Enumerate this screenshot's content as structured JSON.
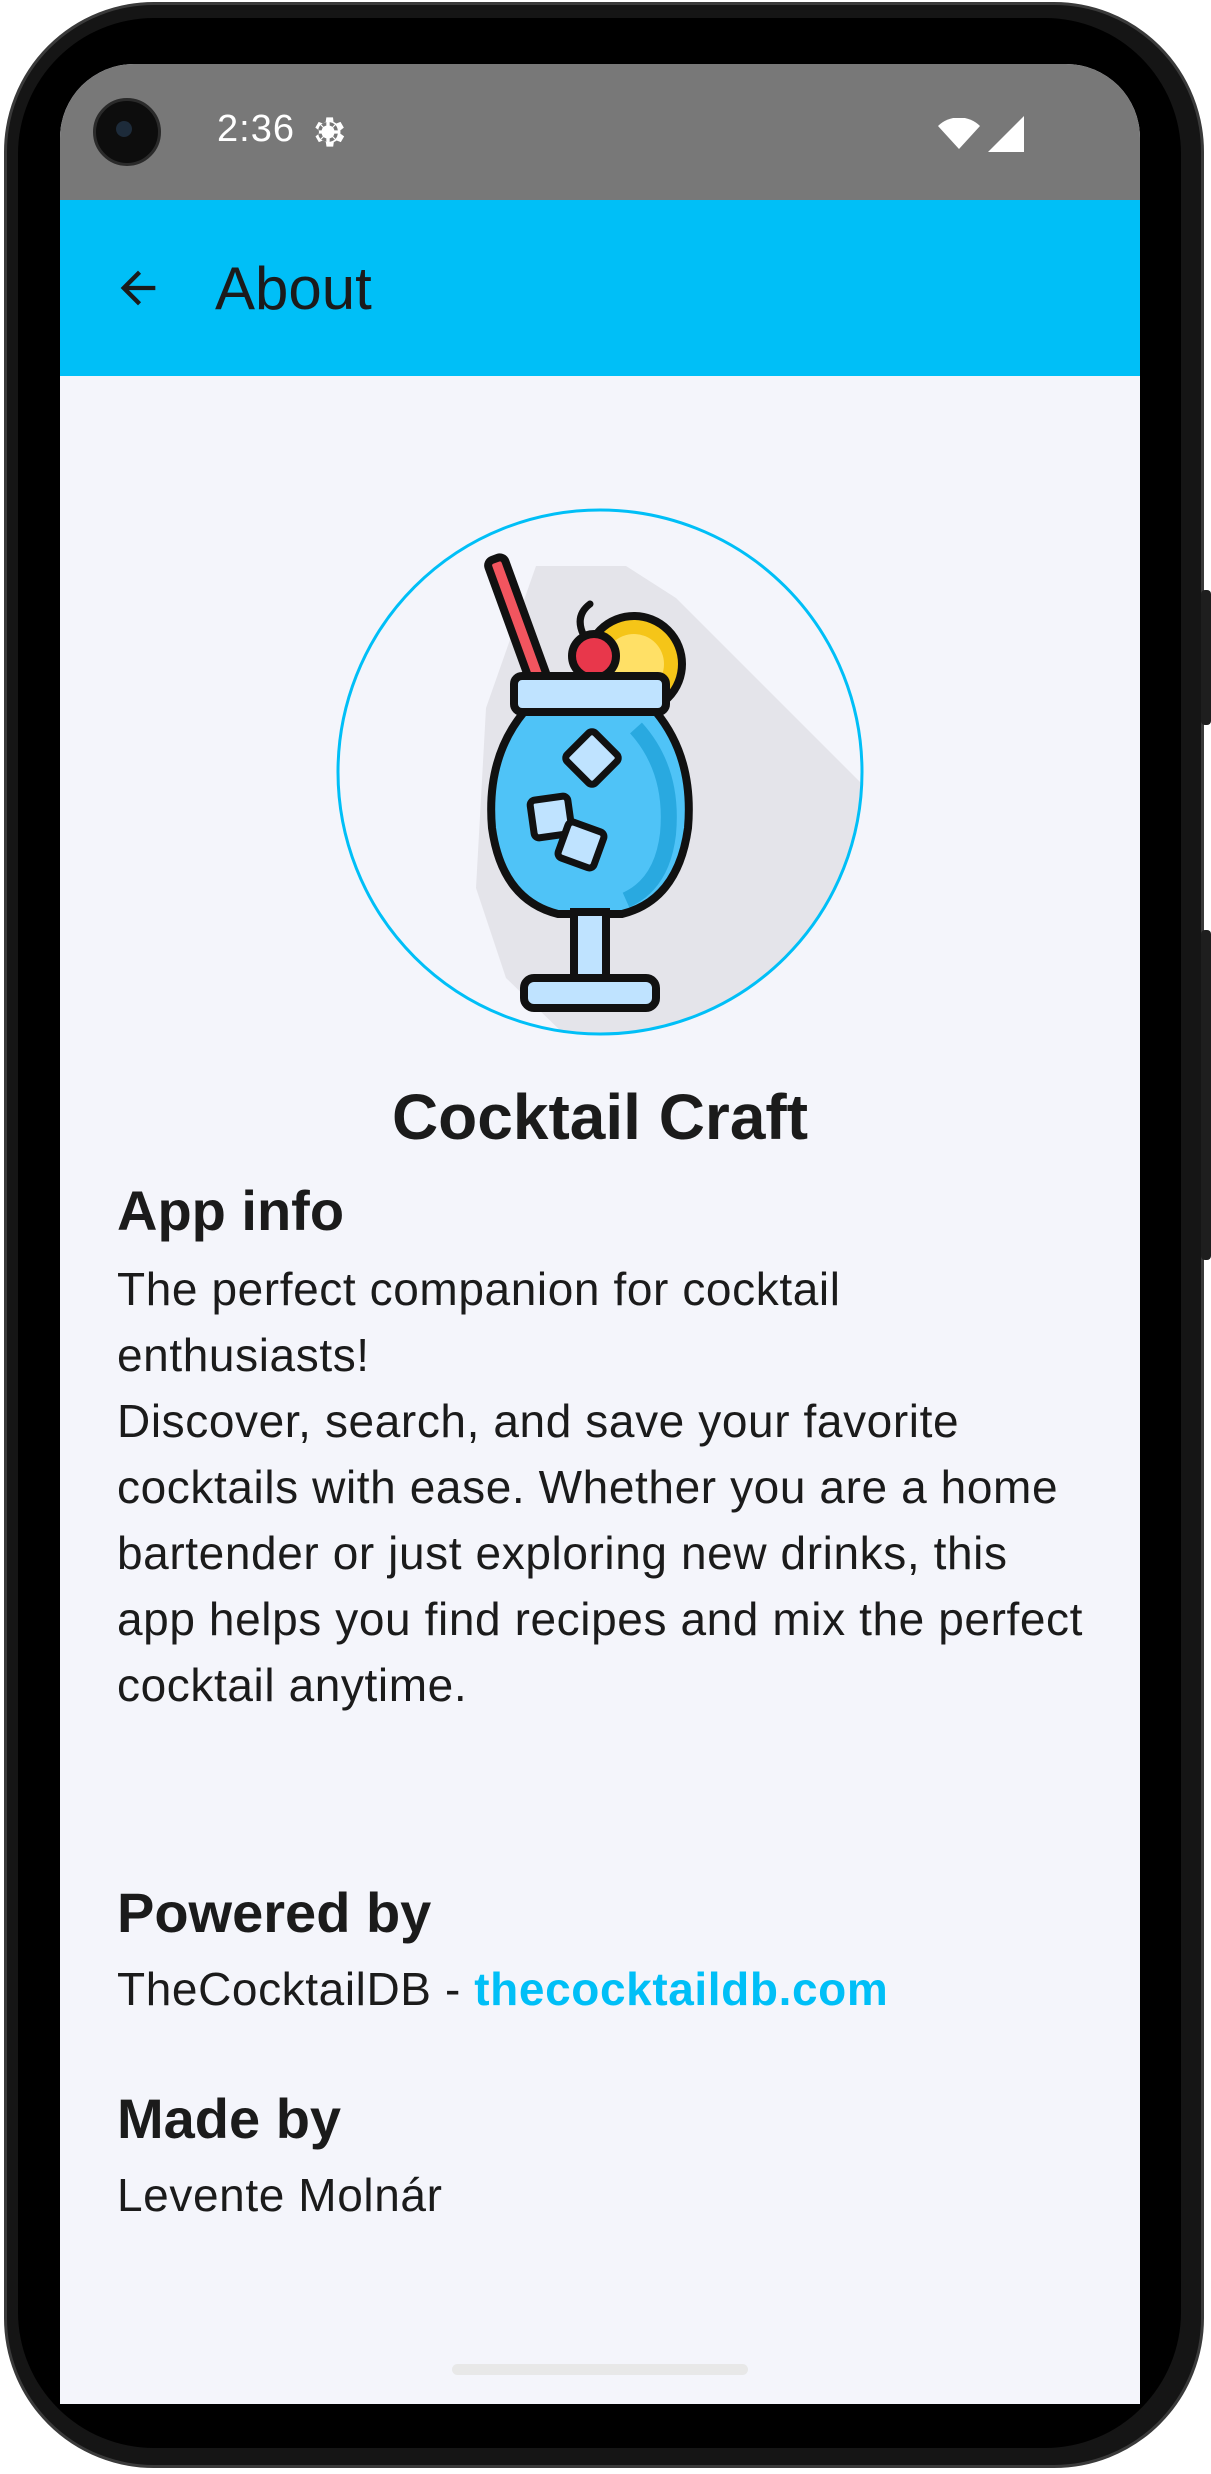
{
  "status_bar": {
    "time": "2:36"
  },
  "app_bar": {
    "title": "About"
  },
  "app_name": "Cocktail Craft",
  "sections": {
    "app_info": {
      "title": "App info",
      "line1": "The perfect companion for cocktail enthusiasts!",
      "line2": "Discover, search, and save your favorite cocktails with ease. Whether you are a home bartender or just exploring new drinks, this app helps you find recipes and mix the perfect cocktail anytime."
    },
    "powered_by": {
      "title": "Powered by",
      "prefix": "TheCocktailDB - ",
      "link": "thecocktaildb.com"
    },
    "made_by": {
      "title": "Made by",
      "author": "Levente Molnár"
    }
  },
  "colors": {
    "accent": "#00bff7",
    "status_bar": "#787878",
    "background": "#f4f5fb",
    "text": "#1b1b1b"
  },
  "icons": {
    "back": "arrow-back-icon",
    "logo": "cocktail-glass-icon",
    "settings": "gear-icon",
    "wifi": "wifi-icon",
    "signal": "cell-signal-icon"
  }
}
